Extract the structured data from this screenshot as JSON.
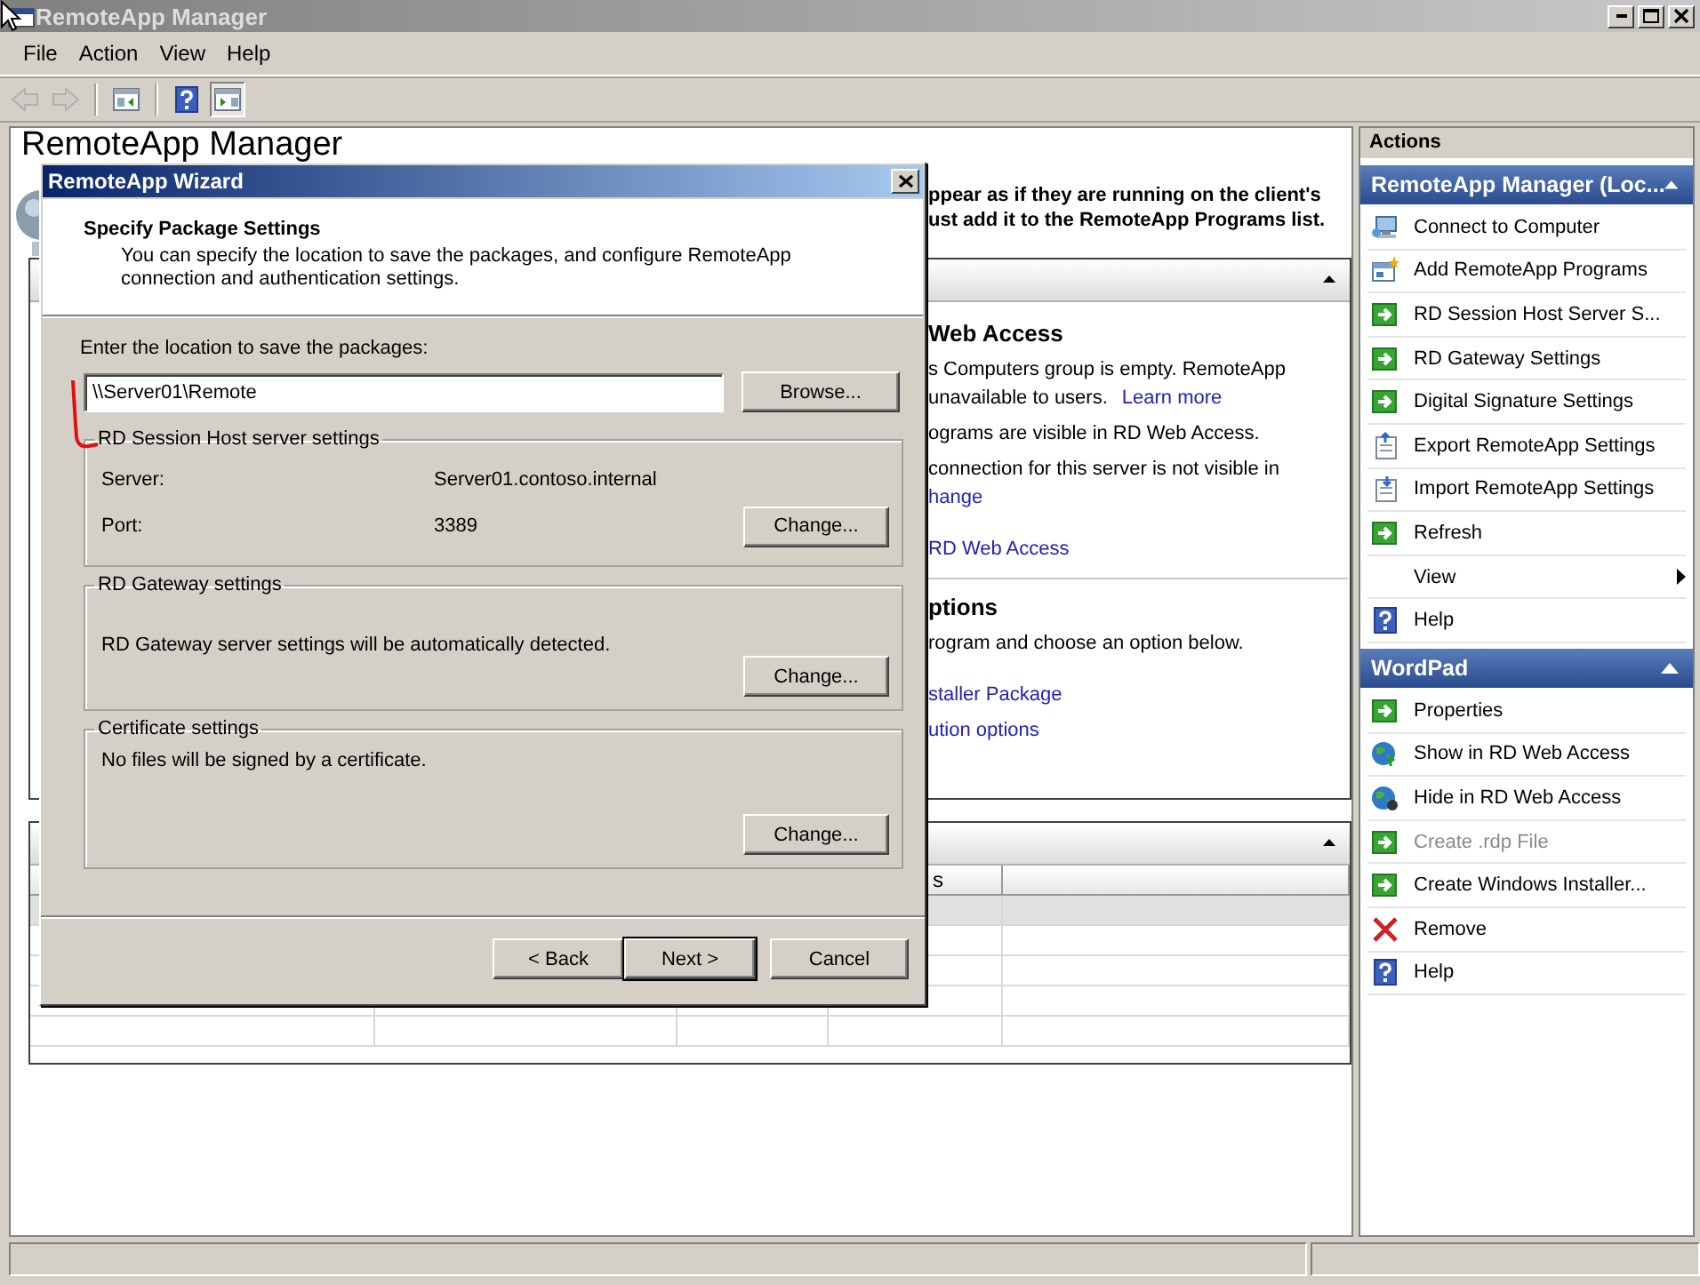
{
  "window": {
    "title": "RemoteApp Manager"
  },
  "menu": [
    {
      "label": "File"
    },
    {
      "label": "Action"
    },
    {
      "label": "View"
    },
    {
      "label": "Help"
    }
  ],
  "toolbar": [
    {
      "kind": "back",
      "disabled": true,
      "pressed": false
    },
    {
      "kind": "forward",
      "disabled": true,
      "pressed": false
    },
    {
      "kind": "separator"
    },
    {
      "kind": "console-tree",
      "disabled": false,
      "pressed": false
    },
    {
      "kind": "separator"
    },
    {
      "kind": "help",
      "disabled": false,
      "pressed": false
    },
    {
      "kind": "action-pane",
      "disabled": false,
      "pressed": true
    }
  ],
  "main": {
    "heading": "RemoteApp Manager",
    "intro_lines": [
      "ppear as if they are running on the client's",
      "ust add it to the RemoteApp Programs list."
    ],
    "overview_panel": {
      "sections": [
        {
          "heading": "Web Access",
          "paragraphs": [
            [
              [
                {
                  "text": "s Computers group is empty. RemoteApp",
                  "kind": "text"
                }
              ],
              [
                {
                  "text": "unavailable to users.",
                  "kind": "text"
                },
                {
                  "text": "Learn more",
                  "kind": "link"
                }
              ]
            ],
            [
              [
                {
                  "text": "ograms are visible in RD Web Access.",
                  "kind": "text"
                }
              ]
            ],
            [
              [
                {
                  "text": "connection for this server is not visible in",
                  "kind": "text"
                }
              ],
              [
                {
                  "text": "hange",
                  "kind": "link"
                }
              ]
            ],
            [
              [
                {
                  "text": "RD Web Access",
                  "kind": "link"
                }
              ]
            ]
          ]
        },
        {
          "heading": "ptions",
          "paragraphs": [
            [
              [
                {
                  "text": "rogram and choose an option below.",
                  "kind": "text"
                }
              ]
            ],
            [
              [
                {
                  "text": "staller Package",
                  "kind": "link"
                }
              ]
            ],
            [
              [
                {
                  "text": "ution options",
                  "kind": "link"
                }
              ]
            ]
          ]
        }
      ]
    },
    "programs_table": {
      "header_text": "s",
      "rows": [
        {
          "selected": true
        },
        {
          "selected": false
        },
        {
          "selected": false
        },
        {
          "selected": false
        },
        {
          "selected": false
        }
      ]
    }
  },
  "actions": {
    "title": "Actions",
    "groups": [
      {
        "title": "RemoteApp Manager (Loc...",
        "expanded": true,
        "items": [
          {
            "label": "Connect to Computer",
            "kind": "connect",
            "disabled": false
          },
          {
            "label": "Add RemoteApp Programs",
            "kind": "add",
            "disabled": false
          },
          {
            "label": "RD Session Host Server S...",
            "kind": "command",
            "disabled": false
          },
          {
            "label": "RD Gateway Settings",
            "kind": "command",
            "disabled": false
          },
          {
            "label": "Digital Signature Settings",
            "kind": "command",
            "disabled": false
          },
          {
            "label": "Export RemoteApp Settings",
            "kind": "export",
            "disabled": false
          },
          {
            "label": "Import RemoteApp Settings",
            "kind": "import",
            "disabled": false
          },
          {
            "label": "Refresh",
            "kind": "command",
            "disabled": false
          },
          {
            "label": "View",
            "kind": "submenu",
            "disabled": false
          },
          {
            "label": "Help",
            "kind": "help",
            "disabled": false
          }
        ]
      },
      {
        "title": "WordPad",
        "expanded": true,
        "items": [
          {
            "label": "Properties",
            "kind": "command",
            "disabled": false
          },
          {
            "label": "Show in RD Web Access",
            "kind": "show",
            "disabled": false
          },
          {
            "label": "Hide in RD Web Access",
            "kind": "hide",
            "disabled": false
          },
          {
            "label": "Create .rdp File",
            "kind": "command",
            "disabled": true
          },
          {
            "label": "Create Windows Installer...",
            "kind": "command",
            "disabled": false
          },
          {
            "label": "Remove",
            "kind": "remove",
            "disabled": false
          },
          {
            "label": "Help",
            "kind": "help",
            "disabled": false
          }
        ]
      }
    ]
  },
  "dialog": {
    "title": "RemoteApp Wizard",
    "heading": "Specify Package Settings",
    "description": "You can specify the location to save the packages, and configure RemoteApp connection and authentication settings.",
    "location_label": "Enter the location to save the packages:",
    "location_value": "\\\\Server01\\Remote",
    "browse_button": "Browse...",
    "groups": [
      {
        "title": "RD Session Host server settings",
        "rows": [
          {
            "label": "Server:",
            "value": "Server01.contoso.internal"
          },
          {
            "label": "Port:",
            "value": "3389"
          }
        ],
        "button": "Change..."
      },
      {
        "title": "RD Gateway settings",
        "text": "RD Gateway server settings will be automatically detected.",
        "button": "Change..."
      },
      {
        "title": "Certificate settings",
        "text": "No files will be signed by a certificate.",
        "button": "Change..."
      }
    ],
    "buttons": [
      {
        "label": "< Back",
        "default": false
      },
      {
        "label": "Next >",
        "default": true
      },
      {
        "label": "Cancel",
        "default": false
      }
    ]
  }
}
